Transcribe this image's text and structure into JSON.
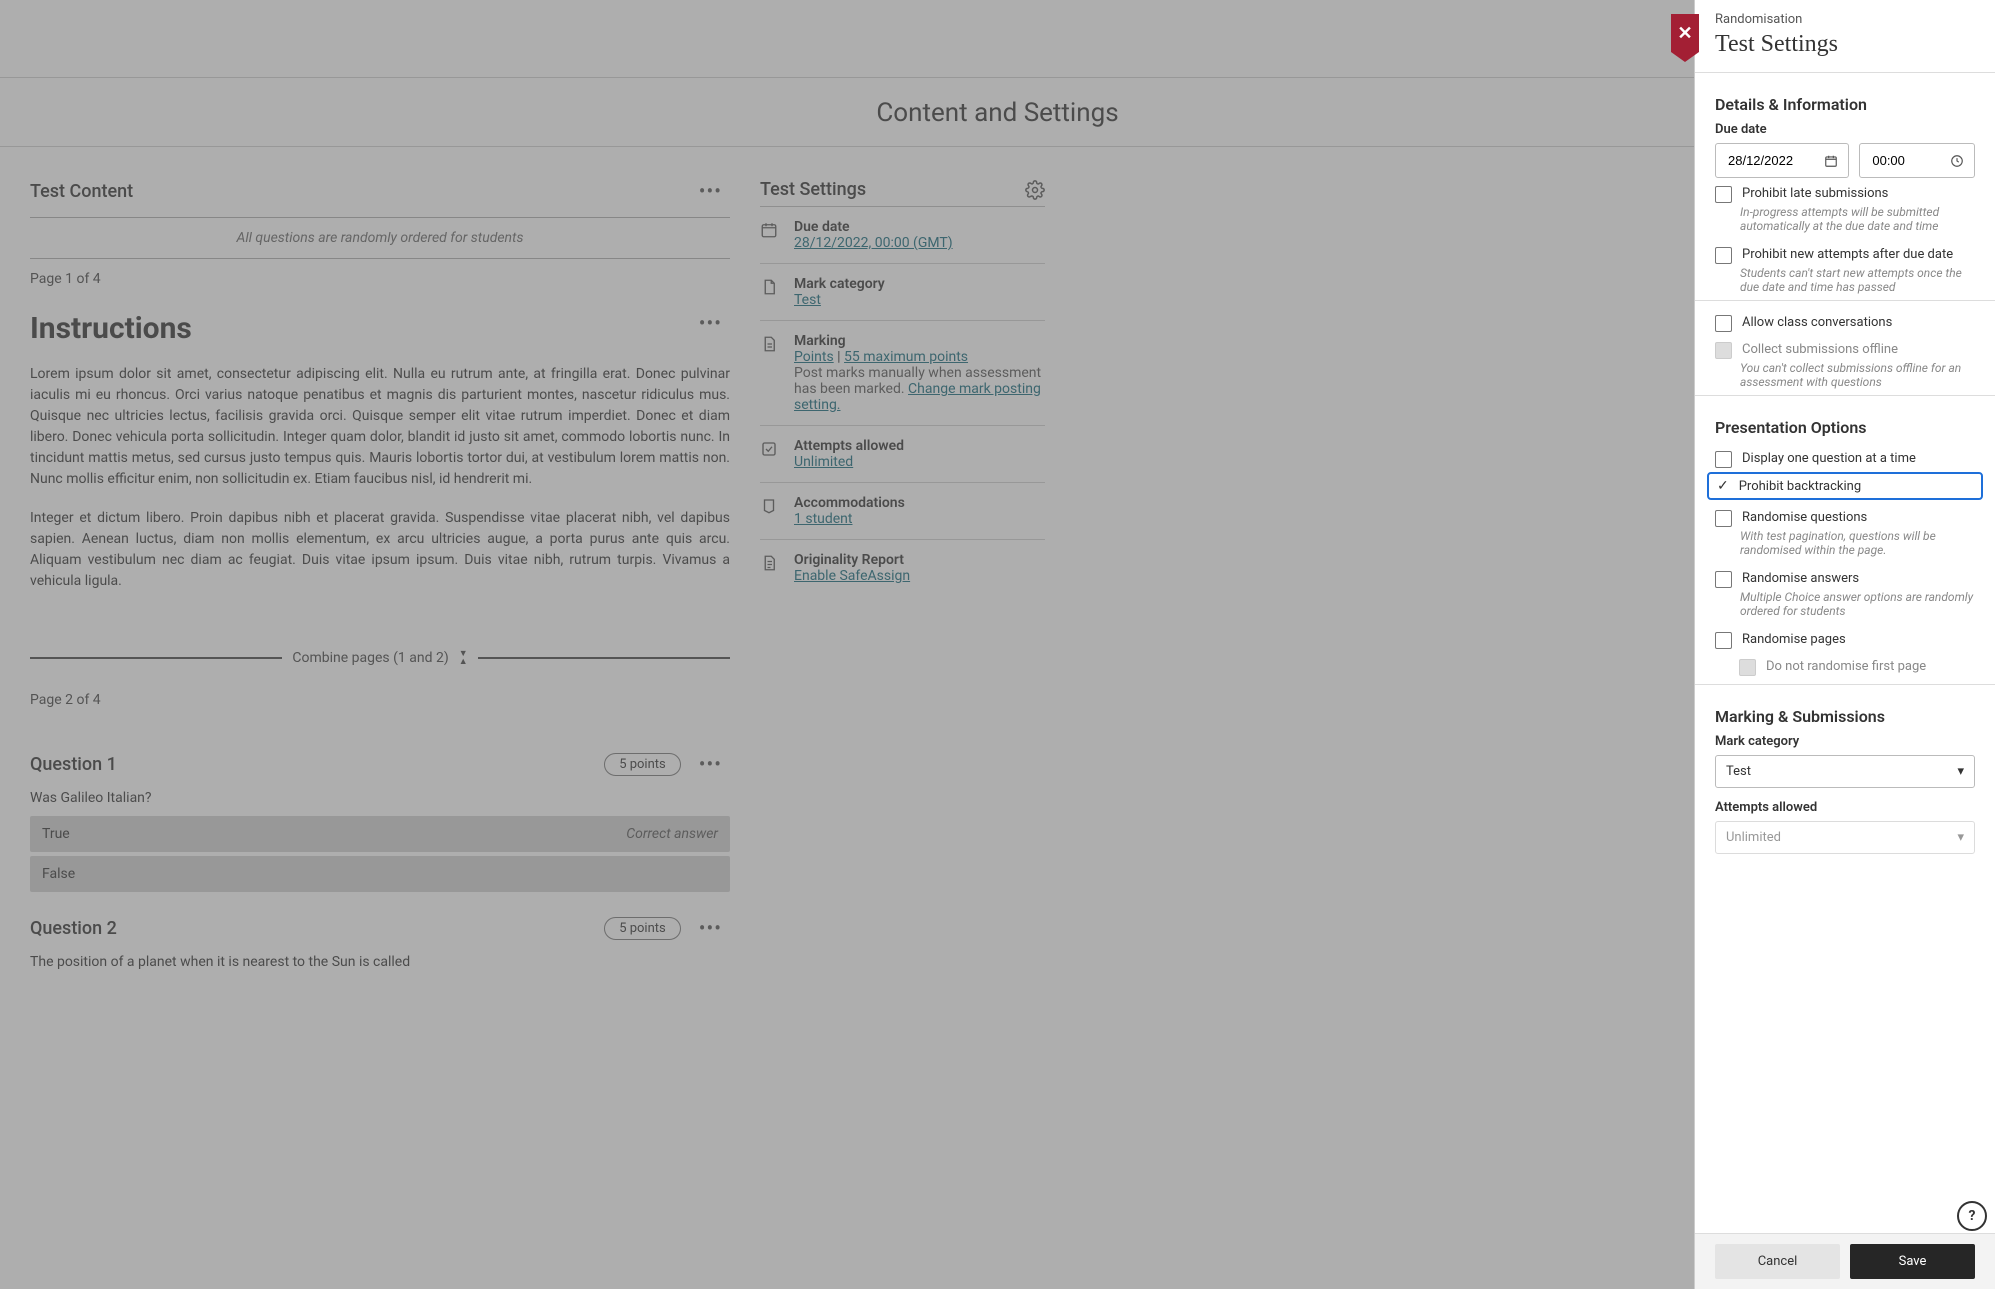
{
  "page": {
    "title": "Content and Settings"
  },
  "content": {
    "heading": "Test Content",
    "randomNote": "All questions are randomly ordered for students",
    "page1": "Page 1 of 4",
    "instructionsTitle": "Instructions",
    "instructionsP1": "Lorem ipsum dolor sit amet, consectetur adipiscing elit. Nulla eu rutrum ante, at fringilla erat. Donec pulvinar iaculis mi eu rhoncus. Orci varius natoque penatibus et magnis dis parturient montes, nascetur ridiculus mus. Quisque nec ultricies lectus, facilisis gravida orci. Quisque semper elit vitae rutrum imperdiet. Donec et diam libero. Donec vehicula porta sollicitudin. Integer quam dolor, blandit id justo sit amet, commodo lobortis nunc. In tincidunt mattis metus, sed cursus justo tempus quis. Mauris lobortis tortor dui, at vestibulum lorem mattis non. Nunc mollis efficitur enim, non sollicitudin ex. Etiam faucibus nisl, id hendrerit mi.",
    "instructionsP2": "Integer et dictum libero. Proin dapibus nibh et placerat gravida. Suspendisse vitae placerat nibh, vel dapibus sapien. Aenean luctus, diam non mollis elementum, ex arcu ultricies augue, a porta purus ante quis arcu. Aliquam vestibulum nec diam ac feugiat. Duis vitae ipsum ipsum. Duis vitae nibh, rutrum turpis. Vivamus a vehicula ligula.",
    "combine": "Combine pages (1 and 2)",
    "page2": "Page 2 of 4",
    "q1": {
      "title": "Question 1",
      "points": "5 points",
      "text": "Was Galileo Italian?",
      "a1": "True",
      "a1tag": "Correct answer",
      "a2": "False"
    },
    "q2": {
      "title": "Question 2",
      "points": "5 points",
      "text": "The position of a planet when it is nearest to the Sun is called"
    }
  },
  "summary": {
    "heading": "Test Settings",
    "items": [
      {
        "label": "Due date",
        "links": [
          "28/12/2022, 00:00 (GMT)"
        ]
      },
      {
        "label": "Mark category",
        "links": [
          "Test"
        ]
      },
      {
        "label": "Marking",
        "links": [
          "Points",
          "55 maximum points"
        ],
        "sep": " | ",
        "note1": "Post marks manually when assessment has been marked. ",
        "link2": "Change mark posting setting."
      },
      {
        "label": "Attempts allowed",
        "links": [
          "Unlimited"
        ]
      },
      {
        "label": "Accommodations",
        "links": [
          "1 student"
        ]
      },
      {
        "label": "Originality Report",
        "links": [
          "Enable SafeAssign"
        ]
      }
    ]
  },
  "panel": {
    "crumb": "Randomisation",
    "title": "Test Settings",
    "details": {
      "heading": "Details & Information",
      "dueLabel": "Due date",
      "dateValue": "28/12/2022",
      "timeValue": "00:00",
      "prohibitLate": "Prohibit late submissions",
      "prohibitLateHelp": "In-progress attempts will be submitted automatically at the due date and time",
      "prohibitNew": "Prohibit new attempts after due date",
      "prohibitNewHelp": "Students can't start new attempts once the due date and time has passed",
      "allowConvo": "Allow class conversations",
      "collectOffline": "Collect submissions offline",
      "collectOfflineHelp": "You can't collect submissions offline for an assessment with questions"
    },
    "presentation": {
      "heading": "Presentation Options",
      "displayOne": "Display one question at a time",
      "prohibitBack": "Prohibit backtracking",
      "randQuestions": "Randomise questions",
      "randQuestionsHelp": "With test pagination, questions will be randomised within the page.",
      "randAnswers": "Randomise answers",
      "randAnswersHelp": "Multiple Choice answer options are randomly ordered for students",
      "randPages": "Randomise pages",
      "noRandFirst": "Do not randomise first page"
    },
    "marking": {
      "heading": "Marking & Submissions",
      "categoryLabel": "Mark category",
      "categoryValue": "Test",
      "attemptsLabel": "Attempts allowed",
      "attemptsValue": "Unlimited"
    },
    "footer": {
      "cancel": "Cancel",
      "save": "Save"
    }
  }
}
